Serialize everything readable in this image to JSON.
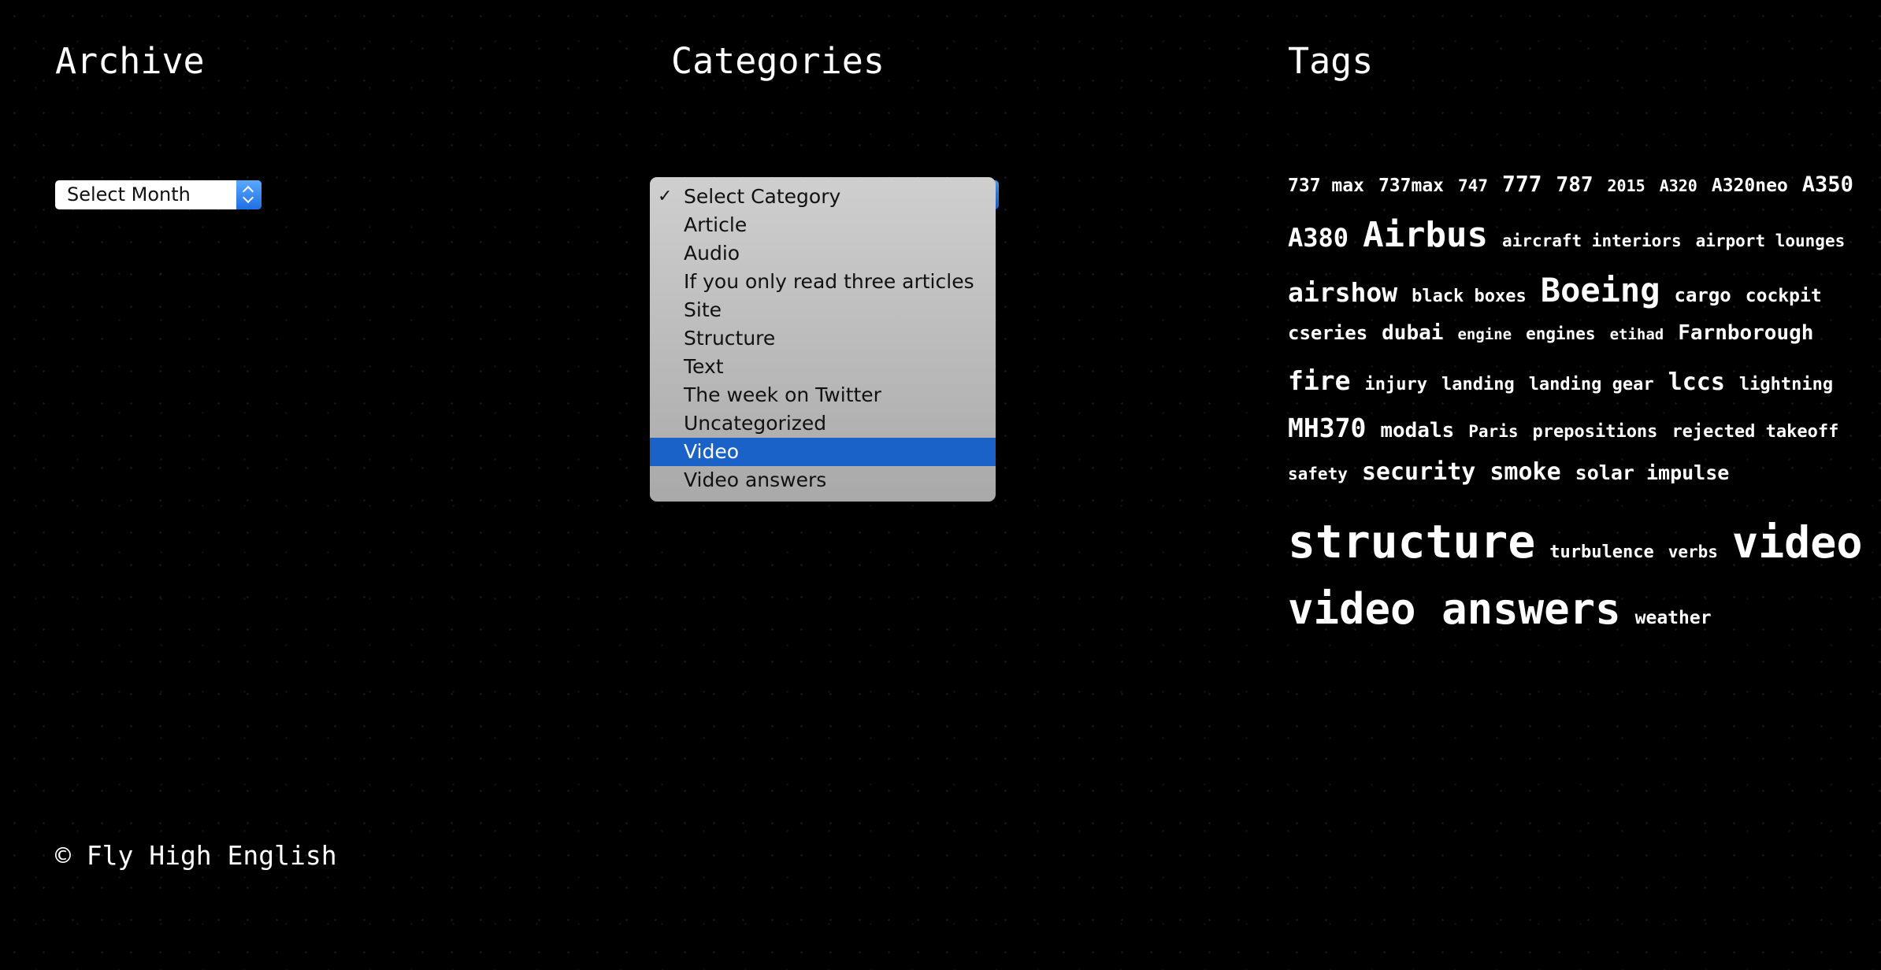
{
  "archive": {
    "title": "Archive",
    "select_value": "Select Month"
  },
  "categories": {
    "title": "Categories",
    "options": [
      "Select Category",
      "Article",
      "Audio",
      "If you only read three articles",
      "Site",
      "Structure",
      "Text",
      "The week on Twitter",
      "Uncategorized",
      "Video",
      "Video answers"
    ],
    "checked_option": "Select Category",
    "highlighted_option": "Video",
    "checkmark": "✓"
  },
  "tags": {
    "title": "Tags",
    "lines": [
      [
        {
          "label": "737 max",
          "size": 23
        },
        {
          "label": "737max",
          "size": 23
        },
        {
          "label": "747",
          "size": 21
        },
        {
          "label": "777",
          "size": 28
        },
        {
          "label": "787",
          "size": 26
        },
        {
          "label": "2015",
          "size": 20
        },
        {
          "label": "A320",
          "size": 20
        },
        {
          "label": "A320neo",
          "size": 23
        },
        {
          "label": "A350",
          "size": 27
        }
      ],
      [
        {
          "label": "A380",
          "size": 32
        },
        {
          "label": "Airbus",
          "size": 44
        },
        {
          "label": "aircraft interiors",
          "size": 21
        },
        {
          "label": "airport lounges",
          "size": 21
        }
      ],
      [
        {
          "label": "airshow",
          "size": 33
        },
        {
          "label": "black boxes",
          "size": 22
        },
        {
          "label": "Boeing",
          "size": 42
        },
        {
          "label": "cargo",
          "size": 24
        },
        {
          "label": "cockpit",
          "size": 23
        }
      ],
      [
        {
          "label": "cseries",
          "size": 24
        },
        {
          "label": "dubai",
          "size": 26
        },
        {
          "label": "engine",
          "size": 19
        },
        {
          "label": "engines",
          "size": 21
        },
        {
          "label": "etihad",
          "size": 19
        },
        {
          "label": "Farnborough",
          "size": 26
        }
      ],
      [
        {
          "label": "fire",
          "size": 33
        },
        {
          "label": "injury",
          "size": 22
        },
        {
          "label": "landing",
          "size": 22
        },
        {
          "label": "landing gear",
          "size": 22
        },
        {
          "label": "lccs",
          "size": 30
        },
        {
          "label": "lightning",
          "size": 22
        }
      ],
      [
        {
          "label": "MH370",
          "size": 33
        },
        {
          "label": "modals",
          "size": 26
        },
        {
          "label": "Paris",
          "size": 21
        },
        {
          "label": "prepositions",
          "size": 22
        },
        {
          "label": "rejected takeoff",
          "size": 22
        }
      ],
      [
        {
          "label": "safety",
          "size": 21
        },
        {
          "label": "security",
          "size": 30
        },
        {
          "label": "smoke",
          "size": 30
        },
        {
          "label": "solar impulse",
          "size": 25
        }
      ],
      [
        {
          "label": "structure",
          "size": 58
        },
        {
          "label": "turbulence",
          "size": 22
        },
        {
          "label": "verbs",
          "size": 21
        },
        {
          "label": "video",
          "size": 55
        }
      ],
      [
        {
          "label": "video answers",
          "size": 54
        },
        {
          "label": "weather",
          "size": 23
        }
      ]
    ]
  },
  "footer": {
    "copyright": "© Fly High English"
  }
}
